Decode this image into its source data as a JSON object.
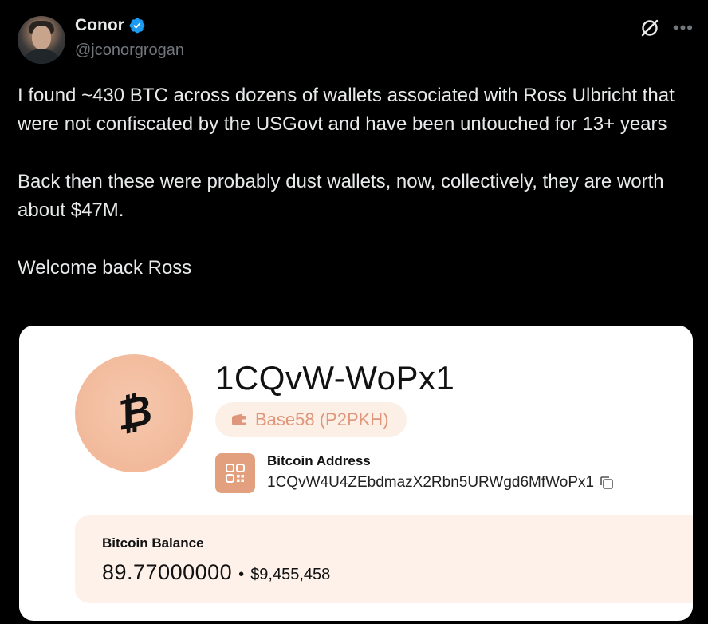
{
  "author": {
    "name": "Conor",
    "handle": "@jconorgrogan",
    "verified": true,
    "verified_color": "#1d9bf0"
  },
  "icons": {
    "grok": "grok-icon",
    "more": "more-options-icon"
  },
  "tweet": {
    "paragraphs": [
      "I found ~430 BTC across dozens of wallets associated with Ross Ulbricht that were not confiscated by the USGovt and have been untouched for 13+ years",
      "Back then these were probably dust wallets, now, collectively, they are worth about $47M.",
      "Welcome back Ross"
    ]
  },
  "card": {
    "coin_symbol": "₿",
    "address_short": "1CQvW-WoPx1",
    "format_label": "Base58 (P2PKH)",
    "address_label": "Bitcoin Address",
    "address_full": "1CQvW4U4ZEbdmazX2Rbn5URWgd6MfWoPx1",
    "balance_label": "Bitcoin Balance",
    "balance_btc": "89.77000000",
    "balance_separator": "•",
    "balance_usd": "$9,455,458",
    "accent_color": "#e0967a"
  }
}
